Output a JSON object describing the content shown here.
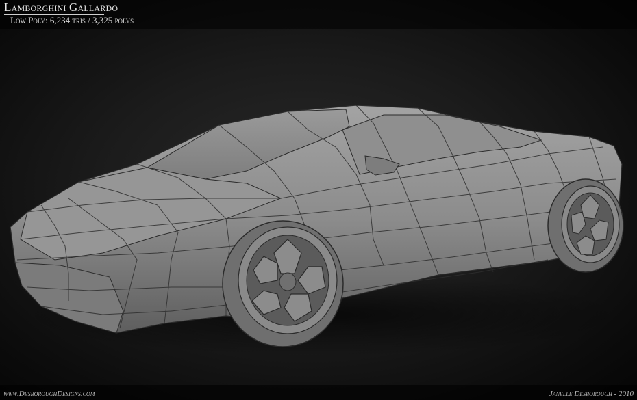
{
  "header": {
    "title": "Lamborghini Gallardo",
    "subtitle": "Low Poly: 6,234 tris / 3,325 polys"
  },
  "footer": {
    "website": "www.DesboroughDesigns.com",
    "credit": "Janelle Desborough - 2010"
  },
  "colors": {
    "background": "#161616",
    "body_shade": "#8a8a8a",
    "wire": "#2a2a2a"
  },
  "image": {
    "subject": "car-wireframe-render"
  }
}
